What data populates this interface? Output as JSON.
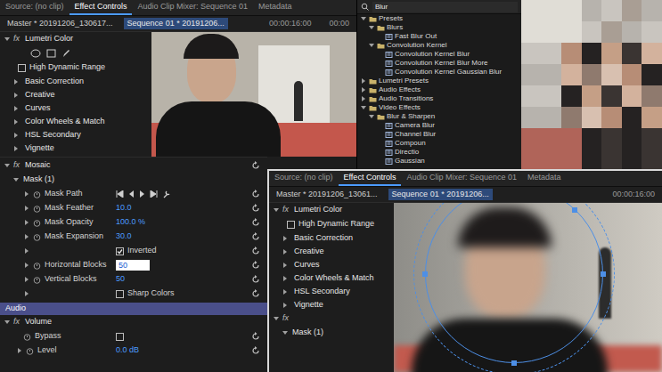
{
  "main_panel": {
    "tabs": [
      {
        "label": "Source: (no clip)",
        "selected": false
      },
      {
        "label": "Effect Controls",
        "selected": true
      },
      {
        "label": "Audio Clip Mixer: Sequence 01",
        "selected": false
      },
      {
        "label": "Metadata",
        "selected": false
      }
    ],
    "master": "Master * 20191206_130617...",
    "sequence": "Sequence 01 * 20191206...",
    "timecodes": [
      "00:00:16:00",
      "00:00"
    ],
    "lumetri": {
      "fx": "fx",
      "name": "Lumetri Color",
      "hdr": {
        "label": "High Dynamic Range",
        "checked": false
      },
      "sections": [
        "Basic Correction",
        "Creative",
        "Curves",
        "Color Wheels & Match",
        "HSL Secondary",
        "Vignette"
      ]
    },
    "mosaic": {
      "fx": "fx",
      "name": "Mosaic",
      "properties": [
        {
          "label": "Mask (1)",
          "kind": "group"
        },
        {
          "label": "Mask Path",
          "kind": "track"
        },
        {
          "label": "Mask Feather",
          "kind": "value",
          "value": "10.0",
          "editing": false
        },
        {
          "label": "Mask Opacity",
          "kind": "value",
          "value": "100.0 %",
          "editing": false
        },
        {
          "label": "Mask Expansion",
          "kind": "value",
          "value": "30.0",
          "editing": false
        },
        {
          "label": "Inverted",
          "kind": "checkbox",
          "checked": true
        },
        {
          "label": "Horizontal Blocks",
          "kind": "value",
          "value": "50",
          "editing": true
        },
        {
          "label": "Vertical Blocks",
          "kind": "value",
          "value": "50",
          "editing": false
        },
        {
          "label": "Sharp Colors",
          "kind": "checkbox",
          "checked": false
        }
      ]
    },
    "audio": {
      "header": "Audio",
      "fx": "fx",
      "name": "Volume",
      "bypass": {
        "label": "Bypass",
        "checked": false
      },
      "level": {
        "label": "Level",
        "value": "0.0 dB"
      }
    }
  },
  "effects_panel": {
    "search": "Blur",
    "items": [
      {
        "label": "Presets",
        "kind": "folder",
        "expanded": true,
        "children": [
          {
            "label": "Blurs",
            "kind": "folder",
            "expanded": true,
            "children": [
              {
                "label": "Fast Blur Out",
                "kind": "effect"
              }
            ]
          },
          {
            "label": "Convolution Kernel",
            "kind": "folder",
            "expanded": true,
            "children": [
              {
                "label": "Convolution Kernel Blur",
                "kind": "effect"
              },
              {
                "label": "Convolution Kernel Blur More",
                "kind": "effect"
              },
              {
                "label": "Convolution Kernel Gaussian Blur",
                "kind": "effect"
              }
            ]
          }
        ]
      },
      {
        "label": "Lumetri Presets",
        "kind": "folder",
        "expanded": false
      },
      {
        "label": "Audio Effects",
        "kind": "folder",
        "expanded": false
      },
      {
        "label": "Audio Transitions",
        "kind": "folder",
        "expanded": false
      },
      {
        "label": "Video Effects",
        "kind": "folder",
        "expanded": true,
        "children": [
          {
            "label": "Blur & Sharpen",
            "kind": "folder",
            "expanded": true,
            "children": [
              {
                "label": "Camera Blur",
                "kind": "effect"
              },
              {
                "label": "Channel Blur",
                "kind": "effect"
              },
              {
                "label": "Compoun",
                "kind": "effect"
              },
              {
                "label": "Directio",
                "kind": "effect"
              },
              {
                "label": "Gaussian",
                "kind": "effect"
              }
            ]
          }
        ]
      }
    ]
  },
  "second_panel": {
    "tabs": [
      {
        "label": "Source: (no clip)",
        "selected": false
      },
      {
        "label": "Effect Controls",
        "selected": true
      },
      {
        "label": "Audio Clip Mixer: Sequence 01",
        "selected": false
      },
      {
        "label": "Metadata",
        "selected": false
      }
    ],
    "master": "Master * 20191206_13061...",
    "sequence": "Sequence 01 * 20191206...",
    "timecode": "00:00:16:00",
    "lumetri": {
      "fx": "fx",
      "name": "Lumetri Color",
      "hdr": {
        "label": "High Dynamic Range",
        "checked": false
      },
      "sections": [
        "Basic Correction",
        "Creative",
        "Curves",
        "Color Wheels & Match",
        "HSL Secondary",
        "Vignette"
      ]
    },
    "next_fx": "fx",
    "mask": "Mask (1)"
  }
}
